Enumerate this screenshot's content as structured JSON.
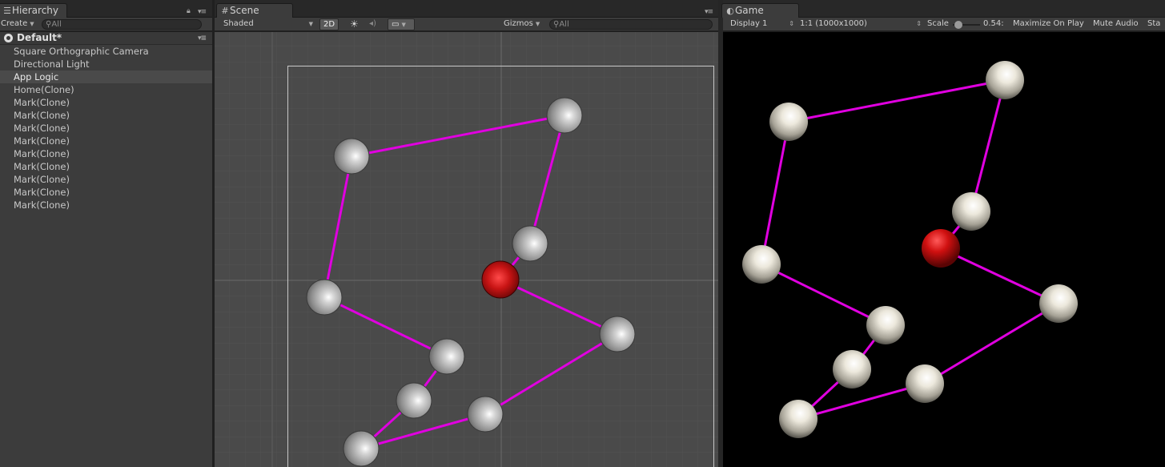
{
  "hierarchy": {
    "tab_label": "Hierarchy",
    "create_label": "Create",
    "search_placeholder": "All",
    "scene_name": "Default*",
    "items": [
      {
        "label": "Square Orthographic Camera",
        "selected": false
      },
      {
        "label": "Directional Light",
        "selected": false
      },
      {
        "label": "App Logic",
        "selected": true
      },
      {
        "label": "Home(Clone)",
        "selected": false
      },
      {
        "label": "Mark(Clone)",
        "selected": false
      },
      {
        "label": "Mark(Clone)",
        "selected": false
      },
      {
        "label": "Mark(Clone)",
        "selected": false
      },
      {
        "label": "Mark(Clone)",
        "selected": false
      },
      {
        "label": "Mark(Clone)",
        "selected": false
      },
      {
        "label": "Mark(Clone)",
        "selected": false
      },
      {
        "label": "Mark(Clone)",
        "selected": false
      },
      {
        "label": "Mark(Clone)",
        "selected": false
      },
      {
        "label": "Mark(Clone)",
        "selected": false
      }
    ]
  },
  "scene": {
    "tab_label": "Scene",
    "shading_mode": "Shaded",
    "mode_2d_label": "2D",
    "gizmos_label": "Gizmos",
    "search_placeholder": "All"
  },
  "game": {
    "tab_label": "Game",
    "display_label": "Display 1",
    "resolution_label": "1:1 (1000x1000)",
    "scale_label": "Scale",
    "scale_value": "0.54:",
    "maximize_label": "Maximize On Play",
    "mute_label": "Mute Audio",
    "stats_label": "Sta"
  },
  "colors": {
    "path_line": "#e000e0",
    "home_sphere": "#cc1010",
    "mark_sphere": "#e8e8e8",
    "scene_bg": "#4a4a4a",
    "game_bg": "#000000"
  }
}
